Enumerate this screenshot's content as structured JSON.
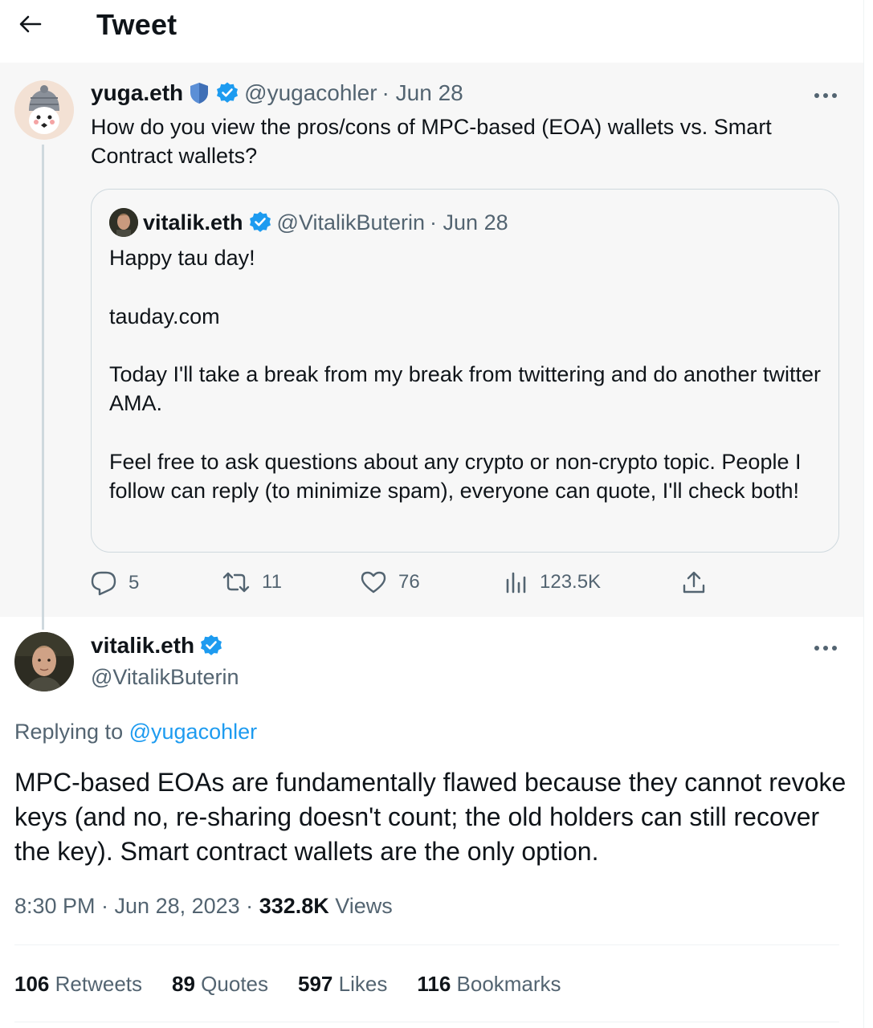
{
  "header": {
    "title": "Tweet"
  },
  "parent_tweet": {
    "author": {
      "name": "yuga.eth",
      "handle": "@yugacohler",
      "date": "· Jun 28"
    },
    "text": "How do you view the pros/cons of MPC-based (EOA) wallets vs. Smart Contract wallets?",
    "quoted": {
      "author": {
        "name": "vitalik.eth",
        "handle": "@VitalikButerin",
        "date": "· Jun 28"
      },
      "paragraphs": [
        "Happy tau day!",
        "tauday.com",
        "Today I'll take a break from my break from twittering and do another twitter AMA.",
        "Feel free to ask questions about any crypto or non-crypto topic. People I follow can reply (to minimize spam), everyone can quote, I'll check both!"
      ]
    },
    "actions": {
      "replies": "5",
      "retweets": "11",
      "likes": "76",
      "views": "123.5K"
    }
  },
  "main_tweet": {
    "author": {
      "name": "vitalik.eth",
      "handle": "@VitalikButerin"
    },
    "replying_prefix": "Replying to",
    "replying_handle": "@yugacohler",
    "text": "MPC-based EOAs are fundamentally flawed because they cannot revoke keys (and no, re-sharing doesn't count; the old holders can still recover the key). Smart contract wallets are the only option.",
    "time": "8:30 PM · Jun 28, 2023 · ",
    "views_count": "332.8K",
    "views_label": " Views",
    "stats": [
      {
        "count": "106",
        "label": "Retweets"
      },
      {
        "count": "89",
        "label": "Quotes"
      },
      {
        "count": "597",
        "label": "Likes"
      },
      {
        "count": "116",
        "label": "Bookmarks"
      }
    ]
  },
  "colors": {
    "accent": "#1d9bf0",
    "muted": "#536471",
    "parent_bg": "#f7f7f7"
  }
}
